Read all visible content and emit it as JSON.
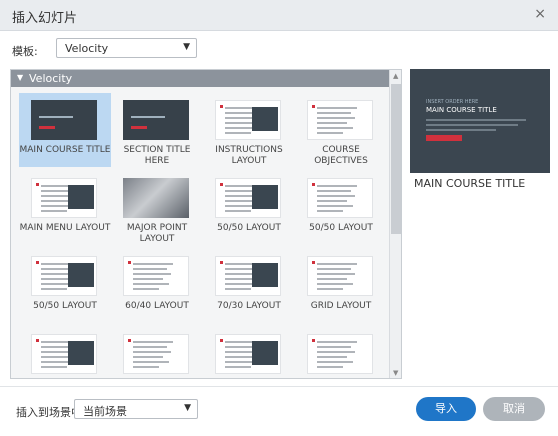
{
  "dialog": {
    "title": "插入幻灯片",
    "close_icon": "×"
  },
  "template": {
    "label": "模板:",
    "value": "Velocity"
  },
  "group": {
    "name": "Velocity"
  },
  "layouts": [
    {
      "label": "MAIN COURSE TITLE",
      "style": "dark",
      "selected": true
    },
    {
      "label": "SECTION TITLE HERE",
      "style": "dark",
      "selected": false
    },
    {
      "label": "INSTRUCTIONS LAYOUT",
      "style": "light",
      "selected": false
    },
    {
      "label": "COURSE OBJECTIVES",
      "style": "light",
      "selected": false
    },
    {
      "label": "MAIN MENU LAYOUT",
      "style": "light",
      "selected": false
    },
    {
      "label": "MAJOR POINT LAYOUT",
      "style": "photo",
      "selected": false
    },
    {
      "label": "50/50 LAYOUT",
      "style": "light",
      "selected": false
    },
    {
      "label": "50/50 LAYOUT",
      "style": "light",
      "selected": false
    },
    {
      "label": "50/50 LAYOUT",
      "style": "light",
      "selected": false
    },
    {
      "label": "60/40 LAYOUT",
      "style": "light",
      "selected": false
    },
    {
      "label": "70/30 LAYOUT",
      "style": "light",
      "selected": false
    },
    {
      "label": "GRID LAYOUT",
      "style": "light",
      "selected": false
    },
    {
      "label": "",
      "style": "light",
      "selected": false
    },
    {
      "label": "",
      "style": "light",
      "selected": false
    },
    {
      "label": "",
      "style": "light",
      "selected": false
    },
    {
      "label": "",
      "style": "light",
      "selected": false
    }
  ],
  "preview": {
    "small_text": "INSERT ORDER HERE",
    "slide_title": "MAIN COURSE TITLE",
    "caption": "MAIN COURSE TITLE"
  },
  "insert_scene": {
    "label": "插入到场景中:",
    "value": "当前场景"
  },
  "buttons": {
    "import": "导入",
    "cancel": "取消"
  },
  "colors": {
    "accent": "#1f76c8",
    "selection": "#bcd8f2",
    "brand_red": "#d0313d"
  }
}
